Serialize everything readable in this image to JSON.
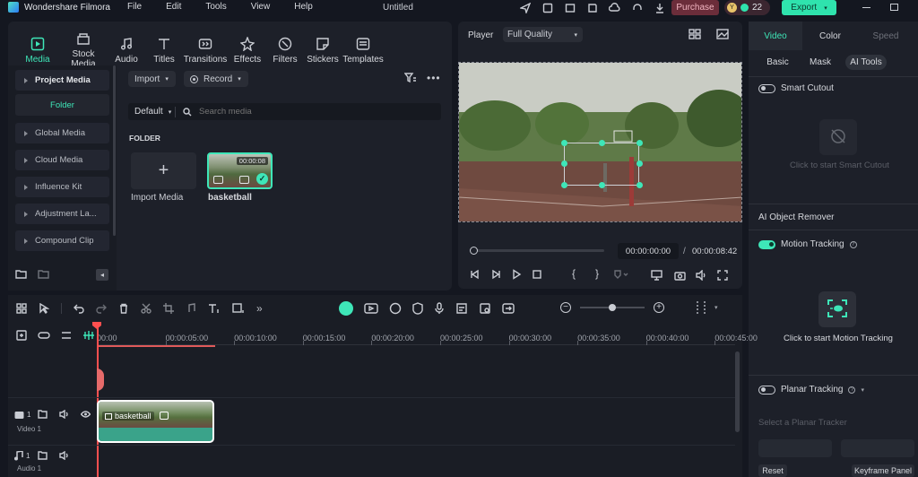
{
  "app": {
    "title": "Wondershare Filmora",
    "document": "Untitled"
  },
  "menu": [
    "File",
    "Edit",
    "Tools",
    "View",
    "Help"
  ],
  "topbar": {
    "purchase": "Purchase",
    "avatar": "Y",
    "credits": "22",
    "export": "Export"
  },
  "media_tabs": [
    "Media",
    "Stock Media",
    "Audio",
    "Titles",
    "Transitions",
    "Effects",
    "Filters",
    "Stickers",
    "Templates"
  ],
  "sidebar": {
    "project_media": "Project Media",
    "folder": "Folder",
    "items": [
      "Global Media",
      "Cloud Media",
      "Influence Kit",
      "Adjustment La...",
      "Compound Clip"
    ]
  },
  "media_toolbar": {
    "import": "Import",
    "record": "Record",
    "sort": "Default",
    "search_placeholder": "Search media"
  },
  "media_content": {
    "folder_heading": "FOLDER",
    "import_label": "Import Media",
    "clip_name": "basketball",
    "clip_duration": "00:00:08"
  },
  "player": {
    "label": "Player",
    "quality": "Full Quality",
    "current_time": "00:00:00:00",
    "separator": "/",
    "total_time": "00:00:08:42",
    "progress": 0.0
  },
  "right_panel": {
    "tabs": [
      "Video",
      "Color",
      "Speed"
    ],
    "subtabs": [
      "Basic",
      "Mask",
      "AI Tools"
    ],
    "smart_cutout": "Smart Cutout",
    "smart_cutout_hint": "Click to start Smart Cutout",
    "ai_object_remover": "AI Object Remover",
    "motion_tracking": "Motion Tracking",
    "motion_tracking_hint": "Click to start Motion Tracking",
    "planar_tracking": "Planar Tracking",
    "planar_tracker_select": "Select a Planar Tracker",
    "reset": "Reset",
    "keyframe_panel": "Keyframe Panel"
  },
  "timeline": {
    "ruler": [
      "00:00",
      "00:00:05:00",
      "00:00:10:00",
      "00:00:15:00",
      "00:00:20:00",
      "00:00:25:00",
      "00:00:30:00",
      "00:00:35:00",
      "00:00:40:00",
      "00:00:45:00"
    ],
    "video_track": "Video 1",
    "audio_track": "Audio 1",
    "track_num": "1",
    "clip_label": "basketball",
    "zoom_level": 0.5
  },
  "colors": {
    "accent": "#3ee6b8",
    "purchase_bg": "#6b2d3a",
    "export_bg": "#2fe3ad",
    "clip_bg": "#3aa38a",
    "playhead": "#ff4f4f"
  }
}
